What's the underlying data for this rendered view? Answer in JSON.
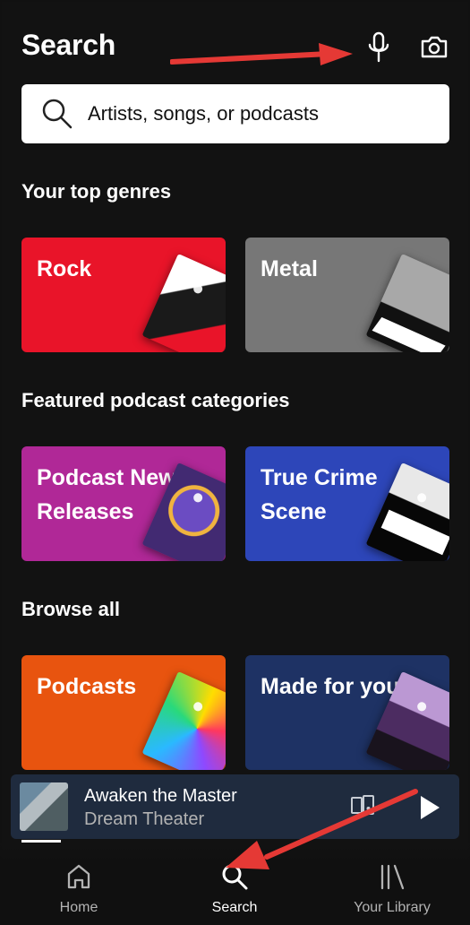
{
  "header": {
    "title": "Search",
    "microphone_icon": "microphone-icon",
    "camera_icon": "camera-icon"
  },
  "search": {
    "placeholder": "Artists, songs, or podcasts",
    "icon": "search-icon"
  },
  "sections": {
    "top_genres": "Your top genres",
    "featured_podcasts": "Featured podcast categories",
    "browse_all": "Browse all"
  },
  "cards": {
    "rock": {
      "label": "Rock",
      "color": "#e91429"
    },
    "metal": {
      "label": "Metal",
      "color": "#777777"
    },
    "podcast_new_releases": {
      "label": "Podcast New Releases",
      "color": "#b02897"
    },
    "true_crime_scene": {
      "label": "True Crime Scene",
      "color": "#2d46b9"
    },
    "podcasts": {
      "label": "Podcasts",
      "color": "#e8540f"
    },
    "made_for_you": {
      "label": "Made for you",
      "color": "#1e3264"
    }
  },
  "player": {
    "track_title": "Awaken the Master",
    "artist": "Dream Theater",
    "devices_icon": "devices-icon",
    "play_icon": "play-icon",
    "progress_fraction": 0.09
  },
  "navigation": {
    "home": "Home",
    "search": "Search",
    "library": "Your Library"
  },
  "colors": {
    "background": "#121212",
    "annotation_arrow": "#e53935"
  }
}
